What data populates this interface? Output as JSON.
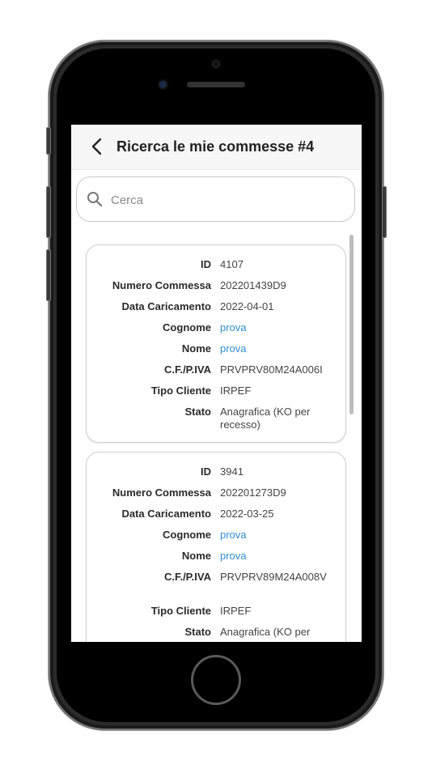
{
  "header": {
    "title": "Ricerca le mie commesse #4"
  },
  "search": {
    "placeholder": "Cerca",
    "value": ""
  },
  "labels": {
    "id": "ID",
    "numero_commessa": "Numero Commessa",
    "data_caricamento": "Data Caricamento",
    "cognome": "Cognome",
    "nome": "Nome",
    "cf_piva": "C.F./P.IVA",
    "tipo_cliente": "Tipo Cliente",
    "stato": "Stato"
  },
  "records": [
    {
      "id": "4107",
      "numero_commessa": "202201439D9",
      "data_caricamento": "2022-04-01",
      "cognome": "prova",
      "nome": "prova",
      "cf_piva": "PRVPRV80M24A006I",
      "tipo_cliente": "IRPEF",
      "stato": "Anagrafica (KO per recesso)"
    },
    {
      "id": "3941",
      "numero_commessa": "202201273D9",
      "data_caricamento": "2022-03-25",
      "cognome": "prova",
      "nome": "prova",
      "cf_piva": "PRVPRV89M24A008V",
      "tipo_cliente": "IRPEF",
      "stato": "Anagrafica (KO per"
    }
  ],
  "colors": {
    "link": "#2f8fd0",
    "header_bg": "#f7f7f7"
  },
  "icons": {
    "back": "chevron-left-icon",
    "search": "search-icon"
  }
}
